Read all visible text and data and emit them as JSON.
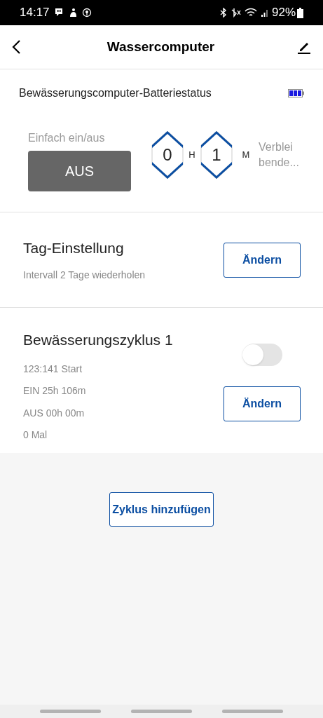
{
  "status_bar": {
    "time": "14:17",
    "battery": "92%"
  },
  "header": {
    "title": "Wassercomputer"
  },
  "battery_status": {
    "label": "Bewässerungscomputer-Batteriestatus"
  },
  "quick_switch": {
    "label": "Einfach ein/aus",
    "button": "AUS",
    "on": false,
    "hours": "0",
    "hours_unit": "H",
    "minutes": "1",
    "minutes_unit": "M",
    "remaining": "Verblei bende..."
  },
  "day_setting": {
    "title": "Tag-Einstellung",
    "subtitle": "Intervall 2 Tage wiederholen",
    "button": "Ändern"
  },
  "cycles": [
    {
      "title": "Bewässerungszyklus 1",
      "lines": [
        "123:141 Start",
        "EIN 25h 106m",
        "AUS 00h 00m",
        "0 Mal"
      ],
      "on": false,
      "button": "Ändern"
    }
  ],
  "add_button": "Zyklus hinzufügen"
}
